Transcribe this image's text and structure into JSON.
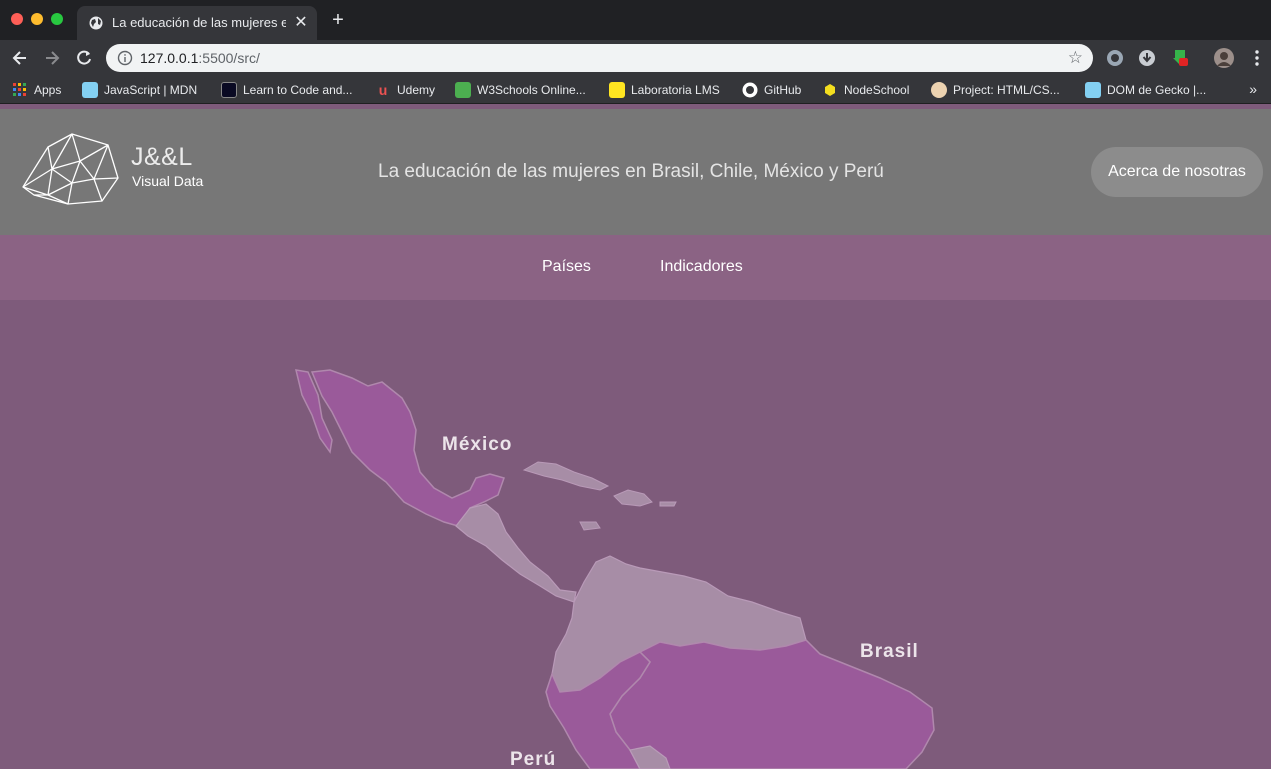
{
  "browser": {
    "tab_title": "La educación de las mujeres en",
    "url_host": "127.0.0.1",
    "url_rest": ":5500/src/",
    "bookmarks": [
      {
        "label": "Apps",
        "color": "#e94235"
      },
      {
        "label": "JavaScript | MDN",
        "color": "#83d0f2"
      },
      {
        "label": "Learn to Code and...",
        "color": "#0a0a23"
      },
      {
        "label": "Udemy",
        "color": "#ec5252"
      },
      {
        "label": "W3Schools Online...",
        "color": "#4caf50"
      },
      {
        "label": "Laboratoria LMS",
        "color": "#ffe521"
      },
      {
        "label": "GitHub",
        "color": "#ffffff"
      },
      {
        "label": "NodeSchool",
        "color": "#f3de1f"
      },
      {
        "label": "Project: HTML/CS...",
        "color": "#ecd2b0"
      },
      {
        "label": "DOM de Gecko |...",
        "color": "#83d0f2"
      }
    ]
  },
  "header": {
    "brand_name": "J&&L",
    "brand_sub": "Visual Data",
    "title": "La educación de las mujeres en Brasil, Chile, México y Perú",
    "about_button": "Acerca de nosotras"
  },
  "nav": {
    "paises": "Países",
    "indicadores": "Indicadores"
  },
  "map": {
    "labels": {
      "mexico": "México",
      "brasil": "Brasil",
      "peru": "Perú"
    },
    "colors": {
      "background": "#7e5b7b",
      "highlight": "#9a5a9a",
      "other": "#a78da6"
    }
  }
}
